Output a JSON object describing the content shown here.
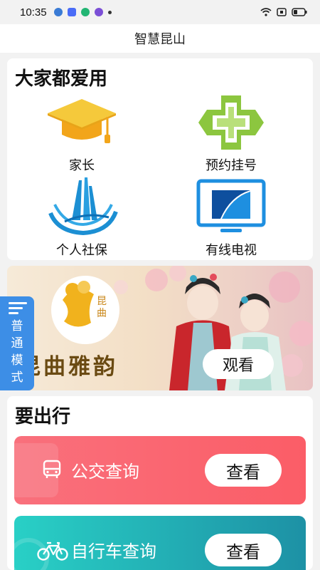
{
  "status": {
    "time": "10:35"
  },
  "app": {
    "title": "智慧昆山"
  },
  "favorites": {
    "title": "大家都爱用",
    "items": [
      {
        "label": "家长",
        "icon": "graduation-cap-icon"
      },
      {
        "label": "预约挂号",
        "icon": "medical-cross-icon"
      },
      {
        "label": "个人社保",
        "icon": "social-security-logo-icon"
      },
      {
        "label": "有线电视",
        "icon": "tv-icon"
      }
    ]
  },
  "banner": {
    "caption": "昆曲雅韵",
    "logo_text": "昆曲",
    "watch_label": "观看"
  },
  "mode_tab": {
    "label": "普通模式"
  },
  "travel": {
    "title": "要出行",
    "items": [
      {
        "label": "公交查询",
        "action": "查看",
        "icon": "bus-icon"
      },
      {
        "label": "自行车查询",
        "action": "查看",
        "icon": "bicycle-icon"
      }
    ]
  },
  "colors": {
    "accent_blue": "#3d8ee6",
    "bus_red": "#fb5d67",
    "bike_teal": "#1d91a5"
  }
}
